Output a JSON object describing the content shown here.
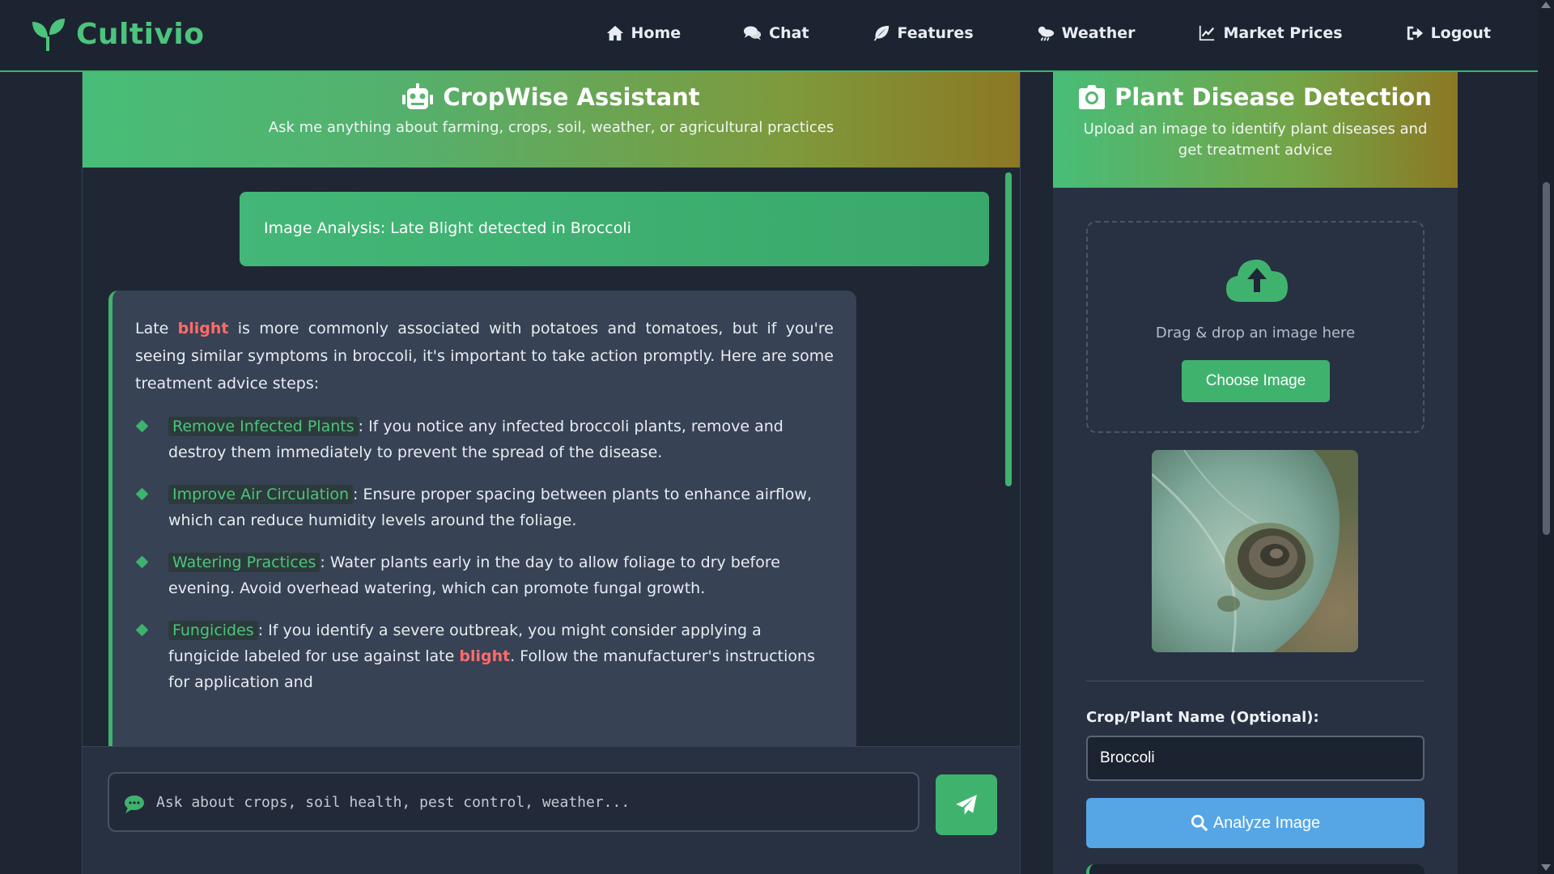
{
  "brand": {
    "name": "Cultivio",
    "color": "#4cc47c"
  },
  "nav": {
    "items": [
      {
        "label": "Home",
        "icon": "home-icon"
      },
      {
        "label": "Chat",
        "icon": "chat-icon"
      },
      {
        "label": "Features",
        "icon": "leaf-icon"
      },
      {
        "label": "Weather",
        "icon": "weather-icon"
      },
      {
        "label": "Market Prices",
        "icon": "chart-line-icon"
      },
      {
        "label": "Logout",
        "icon": "logout-icon"
      }
    ]
  },
  "chat": {
    "title": "CropWise Assistant",
    "subtitle": "Ask me anything about farming, crops, soil, weather, or agricultural practices",
    "user_message": "Image Analysis: Late Blight detected in Broccoli",
    "bot_message": {
      "intro_before": "Late ",
      "intro_highlight": "blight",
      "intro_after": " is more commonly associated with potatoes and tomatoes, but if you're seeing similar symptoms in broccoli, it's important to take action promptly. Here are some treatment advice steps:",
      "tips": [
        {
          "key": "Remove Infected Plants",
          "text": ": If you notice any infected broccoli plants, remove and destroy them immediately to prevent the spread of the disease."
        },
        {
          "key": "Improve Air Circulation",
          "text": ": Ensure proper spacing between plants to enhance airflow, which can reduce humidity levels around the foliage."
        },
        {
          "key": "Watering Practices",
          "text": ": Water plants early in the day to allow foliage to dry before evening. Avoid overhead watering, which can promote fungal growth."
        },
        {
          "key": "Fungicides",
          "text_before": ": If you identify a severe outbreak, you might consider applying a fungicide labeled for use against late ",
          "highlight": "blight",
          "text_after": ". Follow the manufacturer's instructions for application and"
        }
      ]
    },
    "input_placeholder": "Ask about crops, soil health, pest control, weather..."
  },
  "detection": {
    "title": "Plant Disease Detection",
    "subtitle": "Upload an image to identify plant diseases and get treatment advice",
    "drop_text": "Drag & drop an image here",
    "choose_label": "Choose Image",
    "field_label": "Crop/Plant Name (Optional):",
    "crop_value": "Broccoli",
    "analyze_label": "Analyze Image"
  },
  "colors": {
    "accent": "#3fb36e",
    "highlight": "#ff6b6b",
    "analyze": "#56a6e6"
  }
}
